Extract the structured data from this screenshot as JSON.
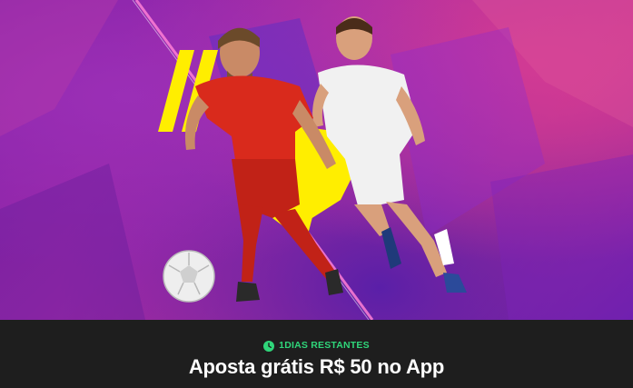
{
  "promo": {
    "countdown": "1DIAS RESTANTES",
    "title": "Aposta grátis R$ 50 no App"
  },
  "colors": {
    "countdown_green": "#2fd67a",
    "footer_bg": "#1e1e1e",
    "accent_yellow": "#ffee00",
    "player1_kit": "#d92a1c",
    "player2_kit": "#f1f1f1"
  },
  "icons": {
    "countdown": "clock-icon"
  }
}
